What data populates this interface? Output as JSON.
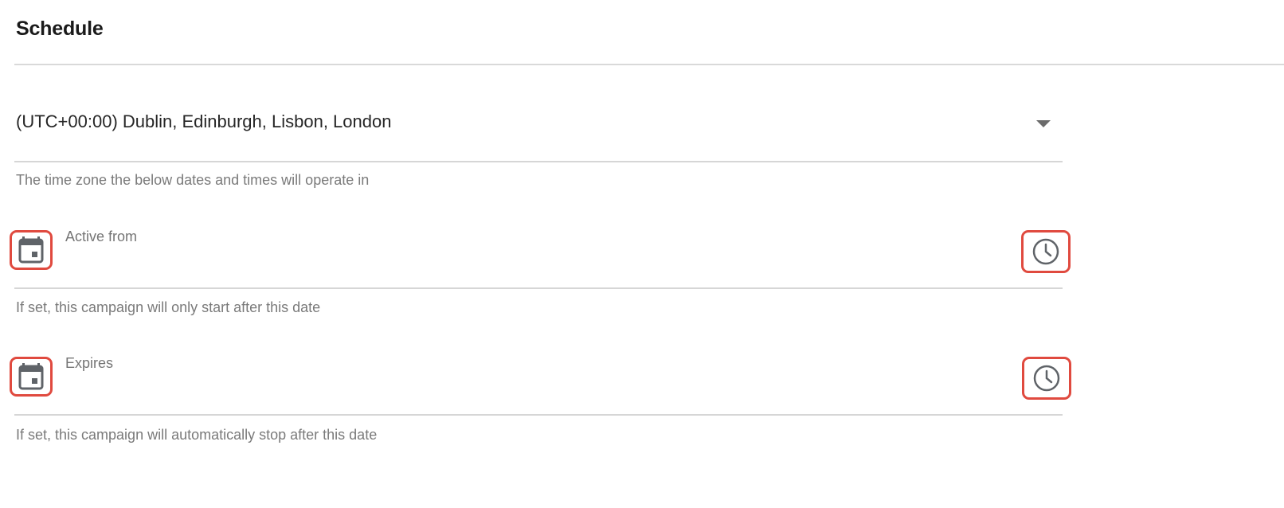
{
  "section": {
    "title": "Schedule"
  },
  "timezone": {
    "value": "(UTC+00:00) Dublin, Edinburgh, Lisbon, London",
    "helper": "The time zone the below dates and times will operate in",
    "arrow_icon": "dropdown-arrow-icon"
  },
  "active_from": {
    "label": "Active from",
    "value": "",
    "helper": "If set, this campaign will only start after this date",
    "date_icon": "calendar-icon",
    "time_icon": "clock-icon"
  },
  "expires": {
    "label": "Expires",
    "value": "",
    "helper": "If set, this campaign will automatically stop after this date",
    "date_icon": "calendar-icon",
    "time_icon": "clock-icon"
  },
  "colors": {
    "highlight_border": "#e04a3f",
    "icon": "#5f6368",
    "divider": "#d6d6d6",
    "helper_text": "#7a7a7a"
  }
}
